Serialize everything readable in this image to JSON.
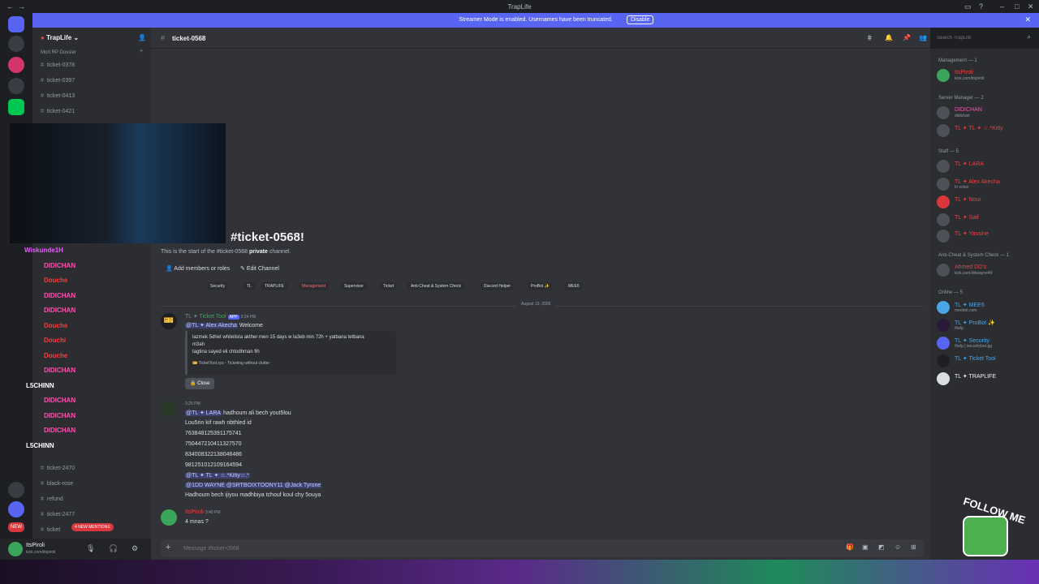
{
  "window": {
    "title": "TrapLife"
  },
  "banner": {
    "text": "Streamer Mode is enabled. Usernames have been truncated.",
    "disable_label": "Disable"
  },
  "sidebar": {
    "server_name": "TrapLife",
    "category": "Mort RP Dossier",
    "channels_top": [
      "ticket-0378",
      "ticket-0397",
      "ticket-0413",
      "ticket-0421"
    ],
    "channels_bottom": [
      "ticket-2470",
      "black-rose",
      "refund",
      "ticket-2477",
      "ticket"
    ],
    "new_mentions": "4 NEW MENTIONS",
    "new_badge": "NEW"
  },
  "userbar": {
    "name": "ItsPiroli",
    "status": "kick.com/itspiroli"
  },
  "header": {
    "channel": "ticket-0568",
    "search_placeholder": "Search TrapLife"
  },
  "welcome": {
    "title": "#ticket-0568!",
    "desc_prefix": "This is the start of the #ticket-0568 ",
    "desc_bold": "private",
    "desc_suffix": " channel.",
    "add_members": "Add members or roles",
    "edit_channel": "Edit Channel"
  },
  "roles": [
    "Security",
    "TL",
    "TRAPLIFE",
    "Management",
    "Supervisor",
    "Ticket",
    "Anti-Cheat & System Check",
    "Discord Helper",
    "ProBot ✨",
    "MEE6"
  ],
  "date_divider": "August 19, 2026",
  "messages": {
    "m1": {
      "author": "Ticket Tool",
      "tag": "APP",
      "time": "3:24 PM",
      "mention": "@TL ✦ Alex Akecha",
      "text": "Welcome",
      "embed_line1": "lazmek 5dhet whitelista akther men 15 days w la3eb min 72h + yatbana tetbana",
      "embed_line1b": "m3ah",
      "embed_line2": "tagtina sayed eli chtodhman fih",
      "embed_footer": "TicketTool.xyz - Ticketing without clutter",
      "close_label": "Close"
    },
    "m2": {
      "time": "3:25 PM",
      "mention": "@TL ✦ LARA",
      "line1": "hadhoum ali bech yout5lou",
      "line2": "Lou5rin kif rawh nbthled id",
      "ids": [
        "763848125391175741",
        "750447210411327570",
        "834008322138046486",
        "981251012109164594"
      ],
      "mention2": "@TL ✦ TL ✦ ☆.*Kitty☆.*",
      "mentions3": "@1DD WAYNE  @SRTBOIXTOONY11  @Jack Tyrone",
      "line3": "Hadhoum bech ijiyou madhbiya tchouf koul chy 5ouya"
    },
    "m3": {
      "author": "ItsPiroli",
      "time": "3:40 PM",
      "text": "4 mnas ?"
    }
  },
  "input": {
    "placeholder": "Message #ticket-0568"
  },
  "members": {
    "sections": [
      {
        "title": "Management — 1"
      },
      {
        "title": "Server Manager — 2"
      },
      {
        "title": "Staff — 5"
      },
      {
        "title": "Anti-Cheat & System Check — 1"
      },
      {
        "title": "Online — 5"
      }
    ],
    "mgmt": [
      {
        "name": "ItsPiroli",
        "sub": "kick.com/itspiroli"
      }
    ],
    "srvmgr": [
      {
        "name": "DIDICHAN",
        "sub": "didichan"
      },
      {
        "name": "TL ✦ TL ✦ ☆.*Kitty",
        "sub": ""
      }
    ],
    "staff": [
      {
        "name": "TL ✦ LARA",
        "sub": ""
      },
      {
        "name": "TL ✦ Alex Akecha",
        "sub": "In voice"
      },
      {
        "name": "TL ✦ Nour",
        "sub": ""
      },
      {
        "name": "TL ✦ Saif",
        "sub": ""
      },
      {
        "name": "TL ✦ Yassine",
        "sub": ""
      }
    ],
    "ac": [
      {
        "name": "Ahmed DD's",
        "sub": "kick.com/ddwayne49"
      }
    ],
    "online": [
      {
        "name": "TL ✦ MEE6",
        "sub": "meebot.com",
        "tag": "APP"
      },
      {
        "name": "TL ✦ ProBot ✨",
        "sub": "/help",
        "tag": "APP"
      },
      {
        "name": "TL ✦ Security",
        "sub": "/help | securitybot.gg",
        "tag": "APP"
      },
      {
        "name": "TL ✦ Ticket Tool",
        "sub": "",
        "tag": "APP"
      },
      {
        "name": "TL ✦ TRAPLIFE",
        "sub": "",
        "tag": "APP"
      }
    ]
  },
  "chat_overlay": [
    {
      "name": "Wiskunde1H",
      "color": "#e85cff"
    },
    {
      "name": "DIDICHAN",
      "color": "#ff4fb0"
    },
    {
      "name": "Douche",
      "color": "#ff3b3b"
    },
    {
      "name": "DIDICHAN",
      "color": "#ff4fb0"
    },
    {
      "name": "DIDICHAN",
      "color": "#ff4fb0"
    },
    {
      "name": "Douche",
      "color": "#ff3b3b"
    },
    {
      "name": "Douchi",
      "color": "#ff3b3b"
    },
    {
      "name": "Douche",
      "color": "#ff3b3b"
    },
    {
      "name": "DIDICHAN",
      "color": "#ff4fb0"
    },
    {
      "name": "L5CHINN",
      "color": "#ffffff"
    },
    {
      "name": "DIDICHAN",
      "color": "#ff4fb0"
    },
    {
      "name": "DIDICHAN",
      "color": "#ff4fb0"
    },
    {
      "name": "DIDICHAN",
      "color": "#ff4fb0"
    },
    {
      "name": "L5CHINN",
      "color": "#ffffff"
    }
  ],
  "follow_text": "FOLLOW ME"
}
